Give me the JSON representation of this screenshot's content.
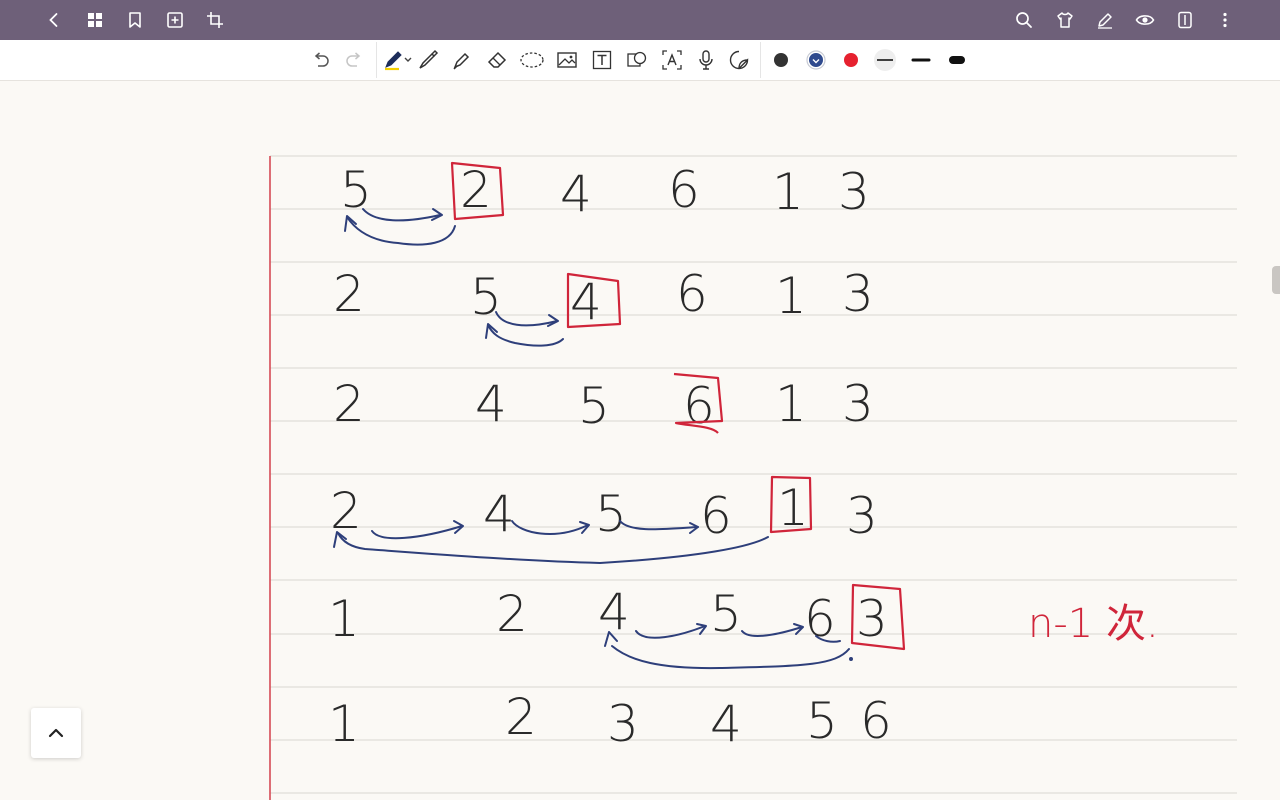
{
  "topbar": {
    "icons": [
      "back-icon",
      "grid-icon",
      "bookmark-icon",
      "add-page-icon",
      "crop-icon",
      "search-icon",
      "template-icon",
      "edit-icon",
      "view-icon",
      "sidebar-icon",
      "more-icon"
    ]
  },
  "toolbar": {
    "tools": [
      "undo-icon",
      "redo-icon",
      "pen-icon",
      "fountain-pen-icon",
      "highlighter-icon",
      "eraser-icon",
      "lasso-icon",
      "image-icon",
      "text-box-icon",
      "shape-icon",
      "ocr-text-icon",
      "microphone-icon",
      "sticker-icon"
    ],
    "colors": [
      "#333333",
      "#2f4a8e",
      "#e6212f"
    ],
    "selected_color": "#2f4a8e",
    "stroke_widths": [
      "thin",
      "medium",
      "thick"
    ],
    "selected_width": "thin"
  },
  "notes": {
    "rows": [
      [
        "5",
        "2",
        "4",
        "6",
        "1",
        "3"
      ],
      [
        "2",
        "5",
        "4",
        "6",
        "1",
        "3"
      ],
      [
        "2",
        "4",
        "5",
        "6",
        "1",
        "3"
      ],
      [
        "2",
        "4",
        "5",
        "6",
        "1",
        "3"
      ],
      [
        "1",
        "2",
        "4",
        "5",
        "6",
        "3"
      ],
      [
        "1",
        "2",
        "3",
        "4",
        "5",
        "6"
      ]
    ],
    "boxed_values": [
      "2",
      "4",
      "6",
      "1",
      "3"
    ],
    "annotation": "n-1 次."
  }
}
